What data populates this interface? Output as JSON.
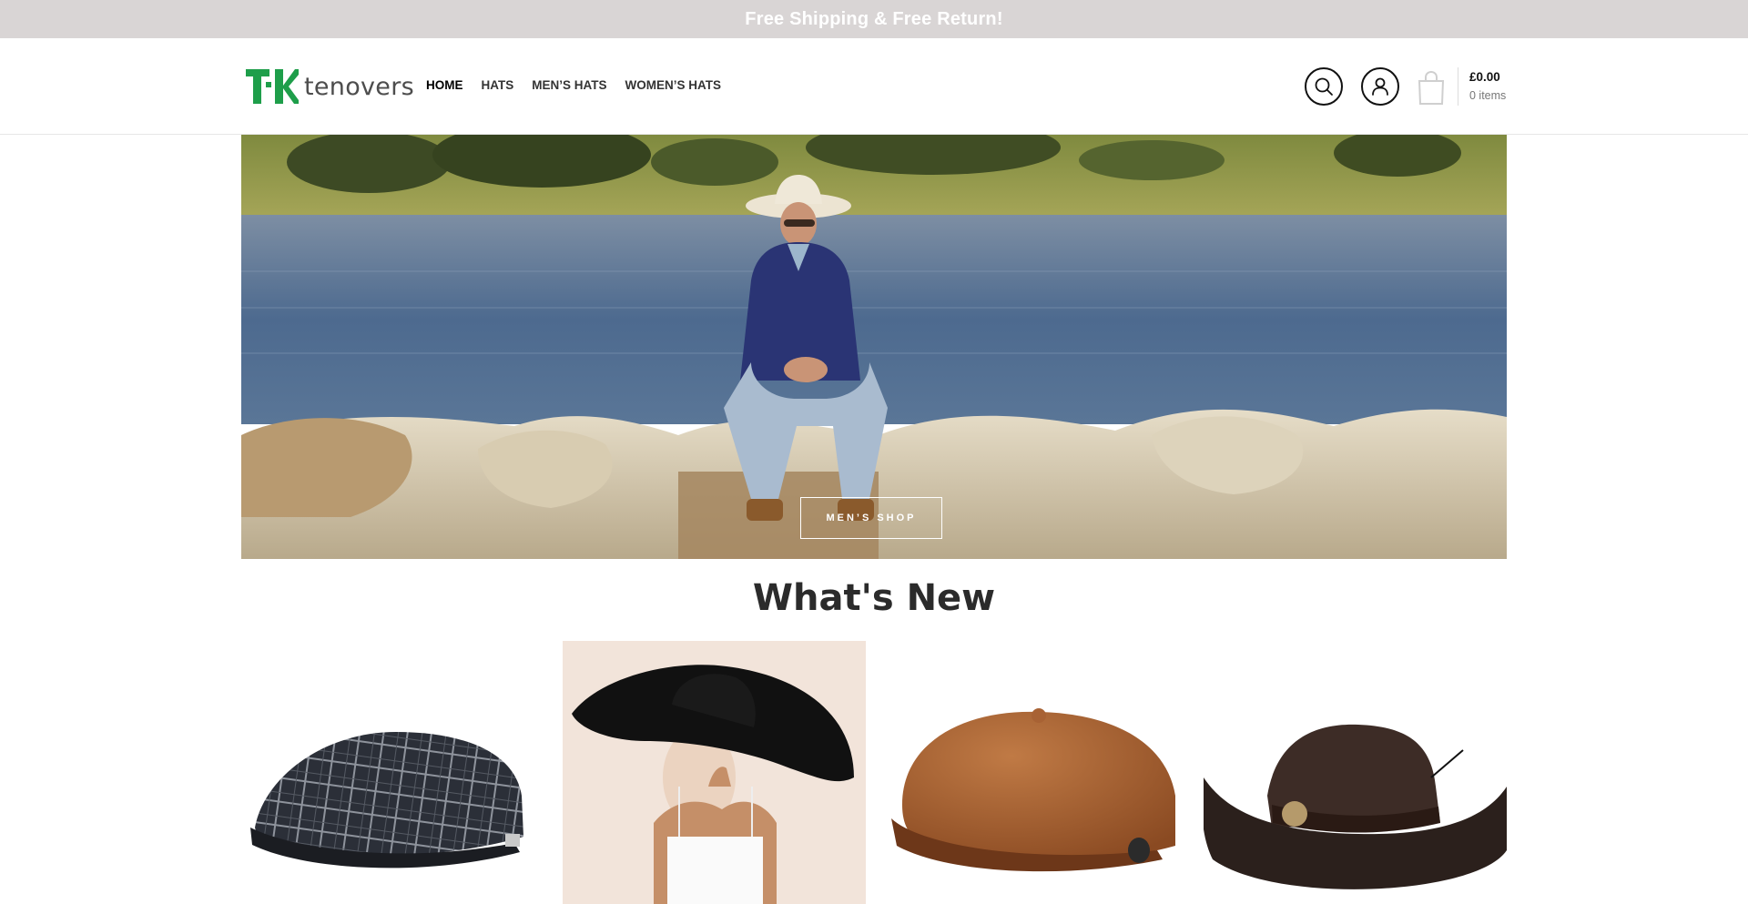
{
  "announcement": {
    "text": "Free Shipping & Free Return!"
  },
  "brand": {
    "name": "tenovers",
    "accent_color": "#1e9e4a"
  },
  "nav": {
    "items": [
      {
        "label": "HOME",
        "active": true
      },
      {
        "label": "HATS"
      },
      {
        "label": "MEN’S HATS"
      },
      {
        "label": "WOMEN’S HATS"
      }
    ]
  },
  "header_icons": {
    "search": "search-icon",
    "account": "user-icon",
    "cart": "shopping-bag-icon"
  },
  "cart": {
    "total": "£0.00",
    "count": "0 items"
  },
  "hero": {
    "button_label": "MEN’S SHOP"
  },
  "section": {
    "title": "What's New"
  },
  "products": [
    {
      "image": "plaid flat cap"
    },
    {
      "image": "wide-brim black sun hat"
    },
    {
      "image": "brown suede newsboy cap"
    },
    {
      "image": "dark straw cowboy hat"
    }
  ]
}
